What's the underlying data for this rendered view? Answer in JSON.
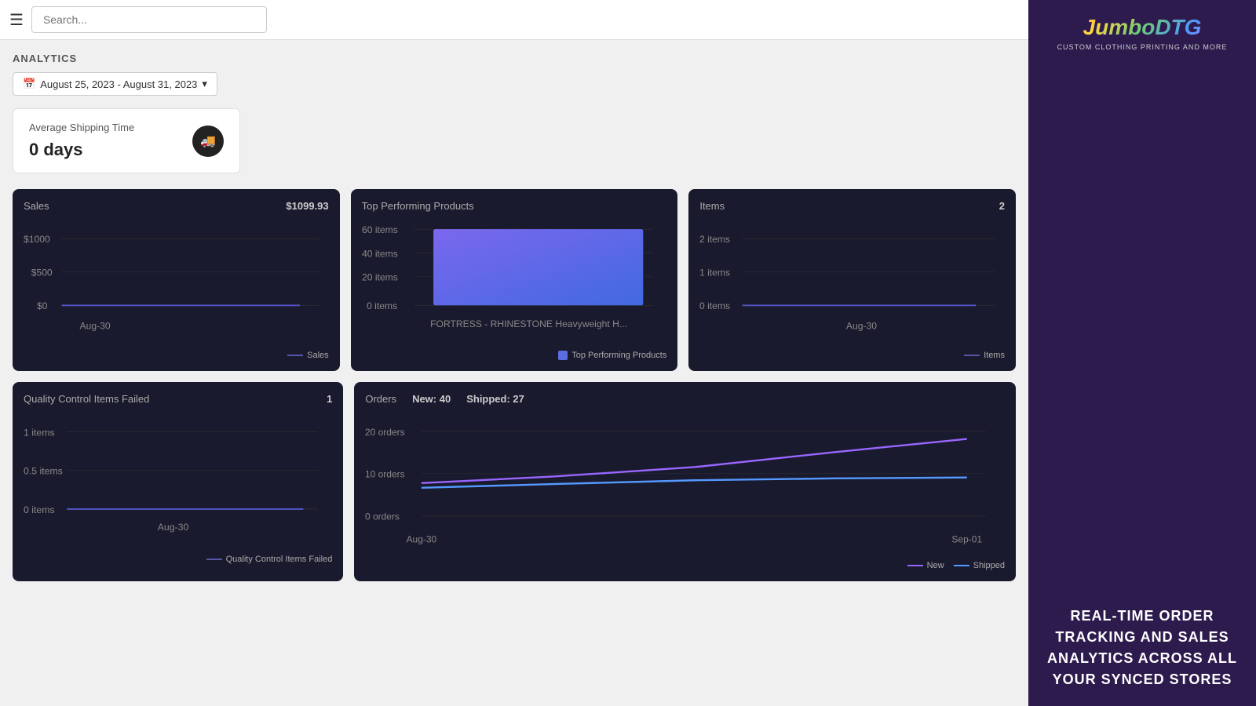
{
  "header": {
    "search_placeholder": "Search...",
    "menu_label": "Menu"
  },
  "analytics": {
    "title": "ANALYTICS",
    "date_range": "August 25, 2023 - August 31, 2023",
    "shipping": {
      "title": "Average Shipping Time",
      "value": "0 days"
    }
  },
  "sales_card": {
    "title": "Sales",
    "value": "$1099.93",
    "y_labels": [
      "$1000",
      "$500",
      "$0"
    ],
    "x_label": "Aug-30",
    "legend": "Sales"
  },
  "top_products_card": {
    "title": "Top Performing Products",
    "y_labels": [
      "60 items",
      "40 items",
      "20 items",
      "0 items"
    ],
    "x_label": "FORTRESS - RHINESTONE Heavyweight H...",
    "legend": "Top Performing Products"
  },
  "items_card": {
    "title": "Items",
    "value": "2",
    "y_labels": [
      "2 items",
      "1 items",
      "0 items"
    ],
    "x_label": "Aug-30",
    "legend": "Items"
  },
  "qc_card": {
    "title": "Quality Control Items Failed",
    "value": "1",
    "y_labels": [
      "1 items",
      "0.5 items",
      "0 items"
    ],
    "x_label": "Aug-30",
    "legend": "Quality Control Items Failed"
  },
  "orders_card": {
    "title": "Orders",
    "new_label": "New: 40",
    "shipped_label": "Shipped: 27",
    "y_labels": [
      "20 orders",
      "10 orders",
      "0 orders"
    ],
    "x_start": "Aug-30",
    "x_end": "Sep-01",
    "legend_new": "New",
    "legend_shipped": "Shipped"
  },
  "sidebar": {
    "logo_text": "JumboDTG",
    "logo_subtitle": "CUSTOM CLOTHING PRINTING AND MORE",
    "promo_text": "REAL-TIME ORDER TRACKING AND SALES ANALYTICS ACROSS ALL YOUR SYNCED STORES"
  }
}
